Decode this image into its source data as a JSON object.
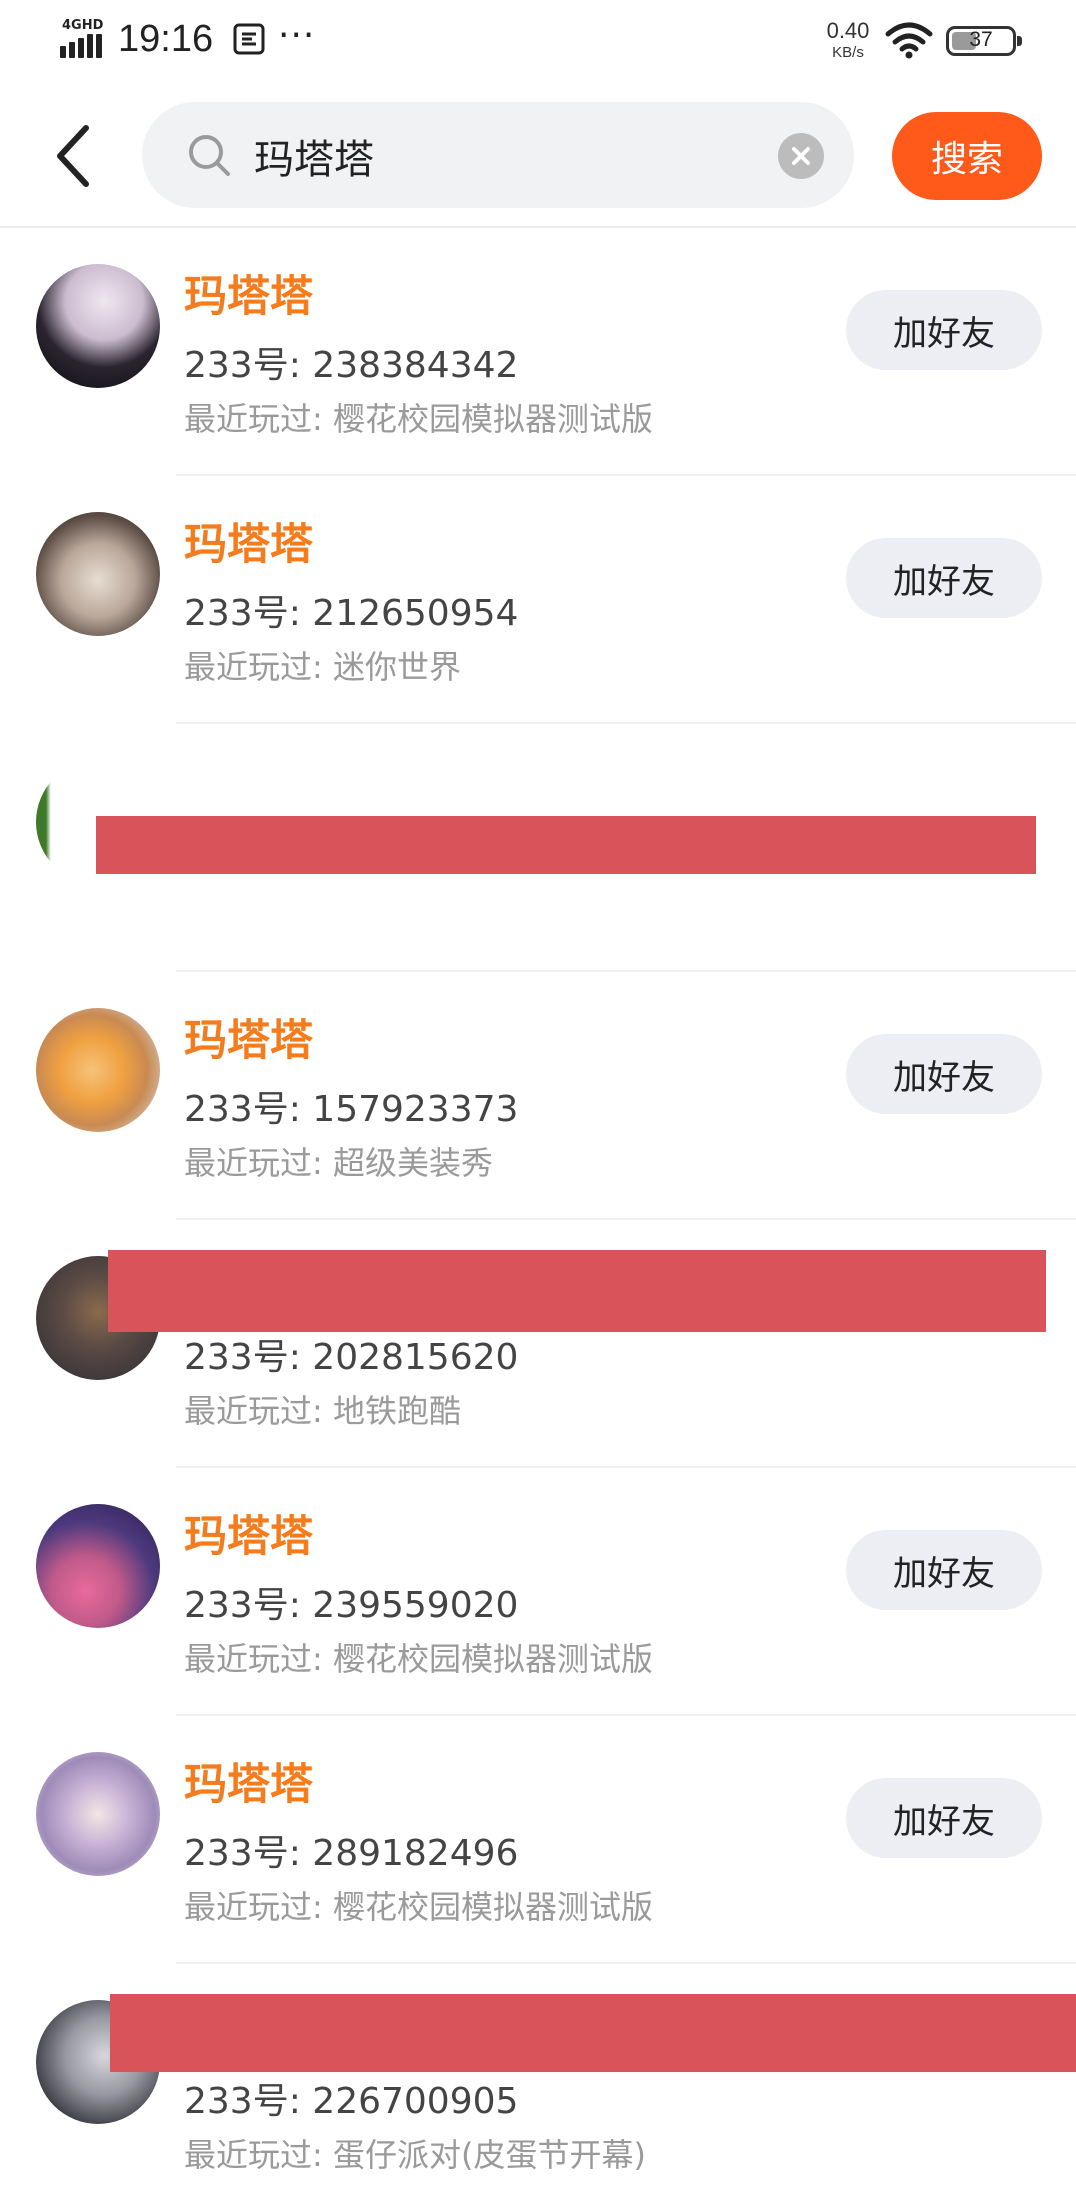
{
  "status_bar": {
    "network": "4GHD",
    "time": "19:16",
    "more": "···",
    "speed_value": "0.40",
    "speed_unit": "KB/s",
    "battery": "37"
  },
  "search": {
    "query": "玛塔塔",
    "button_label": "搜索"
  },
  "results": [
    {
      "name": "玛塔塔",
      "id_line": "233号: 238384342",
      "recent_line": "最近玩过: 樱花校园模拟器测试版",
      "add_label": "加好友",
      "avatar_colors": [
        "#0c0c10",
        "#e8d8e8"
      ]
    },
    {
      "name": "玛塔塔",
      "id_line": "233号: 212650954",
      "recent_line": "最近玩过: 迷你世界",
      "add_label": "加好友",
      "avatar_colors": [
        "#3a3330",
        "#e7ddd2"
      ]
    },
    {
      "redacted": true,
      "avatar_colors": [
        "#3f7a2a",
        "#ffffff"
      ]
    },
    {
      "name": "玛塔塔",
      "id_line": "233号: 157923373",
      "recent_line": "最近玩过: 超级美装秀",
      "add_label": "加好友",
      "avatar_colors": [
        "#f0a040",
        "#dfe6f1"
      ]
    },
    {
      "redacted": true,
      "id_line": "233号: 202815620",
      "recent_line": "最近玩过: 地铁跑酷",
      "avatar_colors": [
        "#2b2b35",
        "#8b6a4d"
      ]
    },
    {
      "name": "玛塔塔",
      "id_line": "233号: 239559020",
      "recent_line": "最近玩过: 樱花校园模拟器测试版",
      "add_label": "加好友",
      "avatar_colors": [
        "#2a1d4e",
        "#e86a9a"
      ]
    },
    {
      "name": "玛塔塔",
      "id_line": "233号: 289182496",
      "recent_line": "最近玩过: 樱花校园模拟器测试版",
      "add_label": "加好友",
      "avatar_colors": [
        "#9f8bb8",
        "#e6dfee"
      ]
    },
    {
      "redacted": true,
      "id_line": "233号: 226700905",
      "recent_line": "最近玩过: 蛋仔派对(皮蛋节开幕)",
      "avatar_colors": [
        "#3b3b44",
        "#d7d7dc"
      ]
    }
  ],
  "colors": {
    "accent": "#ff5a1a",
    "name": "#f47c1c",
    "redaction": "#d9535a"
  }
}
